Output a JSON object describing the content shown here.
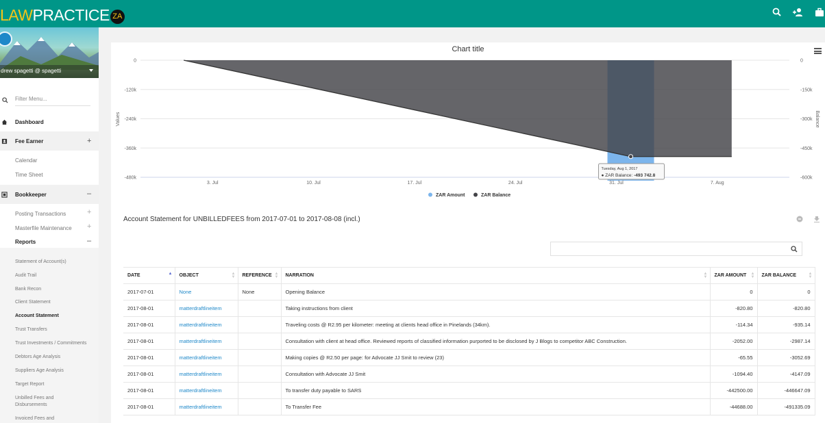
{
  "brand": {
    "law": "LAW",
    "practice": "PRACTICE",
    "za": "ZA"
  },
  "colors": {
    "topbar": "#009688",
    "accent": "#f5c518",
    "link": "#1e88c9",
    "series_amount": "#7cb5ec",
    "series_balance": "#434348"
  },
  "header_icons": [
    "search-icon",
    "add-user-icon",
    "briefcase-icon"
  ],
  "sidebar": {
    "user": "drew spagetti @ spagetti",
    "filter_placeholder": "Filter Menu...",
    "dashboard": "Dashboard",
    "fee_earner": "Fee Earner",
    "calendar": "Calendar",
    "timesheet": "Time Sheet",
    "bookkeeper": "Bookkeeper",
    "posting": "Posting Transactions",
    "masterfile": "Masterfile Maintenance",
    "reports": "Reports",
    "report_items": [
      "Statement of Account(s)",
      "Audit Trail",
      "Bank Recon",
      "Client Statement",
      "Account Statement",
      "Trust Transfers",
      "Trust Investments / Commitments",
      "Debtors Age Analysis",
      "Suppliers Age Analysis",
      "Target Report",
      "Unbilled Fees and Disbursements",
      "Invoiced Fees and"
    ]
  },
  "chart_data": {
    "type": "area",
    "title": "Chart title",
    "ylabel": "Values",
    "ylabel_right": "Balance",
    "ylim": [
      -480000,
      0
    ],
    "yticks": [
      "0",
      "-120k",
      "-240k",
      "-360k",
      "-480k"
    ],
    "ylim_right": [
      -600000,
      0
    ],
    "yticks_right": [
      "0",
      "-150k",
      "-300k",
      "-450k",
      "-600k"
    ],
    "xticks": [
      "3. Jul",
      "10. Jul",
      "17. Jul",
      "24. Jul",
      "31. Jul",
      "7. Aug"
    ],
    "x_dates": [
      "2017-07-01",
      "2017-08-01",
      "2017-08-08"
    ],
    "series": [
      {
        "name": "ZAR Amount",
        "type": "column",
        "points": [
          {
            "x": "2017-08-01",
            "y": -493742.8
          }
        ]
      },
      {
        "name": "ZAR Balance",
        "type": "area",
        "points": [
          {
            "x": "2017-07-01",
            "y": 0
          },
          {
            "x": "2017-08-01",
            "y": -493742.8
          },
          {
            "x": "2017-08-08",
            "y": -493742.8
          }
        ]
      }
    ],
    "legend_position": "bottom-center",
    "tooltip": {
      "date": "Tuesday, Aug 1, 2017",
      "series": "ZAR Balance: ",
      "value": "-493 742.8"
    }
  },
  "statement": {
    "title": "Account Statement for UNBILLEDFEES from 2017-07-01 to 2017-08-08 (incl.)",
    "columns": [
      "DATE",
      "OBJECT",
      "REFERENCE",
      "NARRATION",
      "ZAR AMOUNT",
      "ZAR BALANCE"
    ],
    "rows": [
      [
        "2017-07-01",
        "None",
        "None",
        "Opening Balance",
        "0",
        "0"
      ],
      [
        "2017-08-01",
        "matterdraftlineitem",
        "",
        "Taking instructions from client",
        "-820.80",
        "-820.80"
      ],
      [
        "2017-08-01",
        "matterdraftlineitem",
        "",
        "Traveling costs @ R2.95 per kilometer: meeting at clients head office in Pinelands (34km).",
        "-114.34",
        "-935.14"
      ],
      [
        "2017-08-01",
        "matterdraftlineitem",
        "",
        "Consultation with client at head office. Reviewed reports of classified information purported to be disclosed by J Blogs to competitor ABC Construction.",
        "-2052.00",
        "-2987.14"
      ],
      [
        "2017-08-01",
        "matterdraftlineitem",
        "",
        "Making copies @ R2.50 per page: for Advocate JJ Smit to review (23)",
        "-65.55",
        "-3052.69"
      ],
      [
        "2017-08-01",
        "matterdraftlineitem",
        "",
        "Consultation with Advocate JJ Smit",
        "-1094.40",
        "-4147.09"
      ],
      [
        "2017-08-01",
        "matterdraftlineitem",
        "",
        "To transfer duty payable to SARS",
        "-442500.00",
        "-446647.09"
      ],
      [
        "2017-08-01",
        "matterdraftlineitem",
        "",
        "To Transfer Fee",
        "-44688.00",
        "-491335.09"
      ]
    ]
  }
}
